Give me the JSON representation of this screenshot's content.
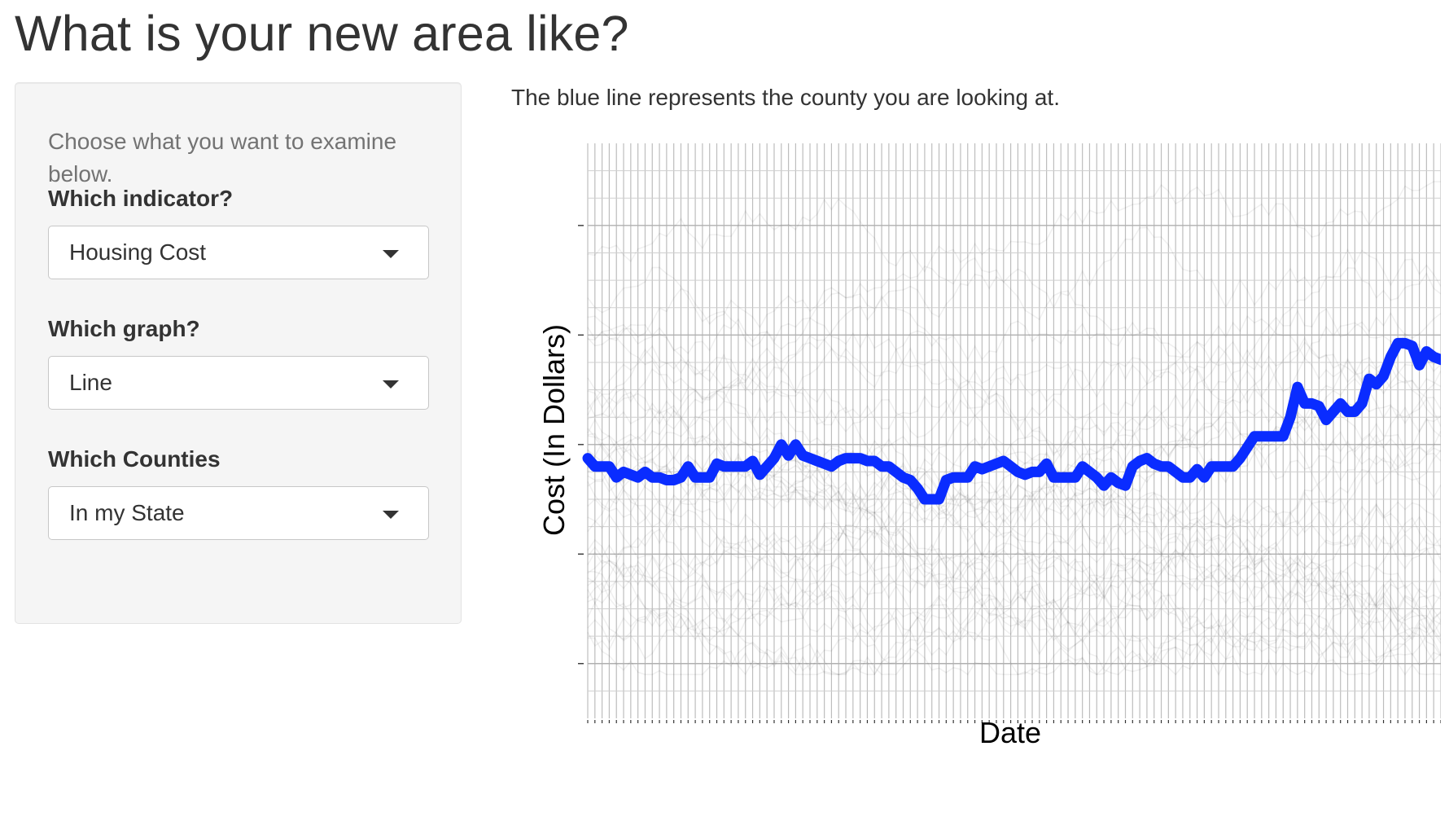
{
  "page": {
    "title": "What is your new area like?"
  },
  "sidebar": {
    "intro": "Choose what you want to examine below.",
    "indicator": {
      "label": "Which indicator?",
      "selected": "Housing Cost",
      "icon": "chevron-down-icon"
    },
    "graph": {
      "label": "Which graph?",
      "selected": "Line",
      "icon": "chevron-down-icon"
    },
    "counties": {
      "label": "Which Counties",
      "selected": "In my State",
      "icon": "chevron-down-icon"
    }
  },
  "main": {
    "caption": "The blue line represents the county you are looking at."
  },
  "chart_data": {
    "type": "line",
    "title": "",
    "xlabel": "Date",
    "ylabel": "Cost (In Dollars)",
    "x_tick_labels_visible": false,
    "y_tick_labels_visible": false,
    "ylim": [
      0,
      10.5
    ],
    "y_major_ticks": [
      1,
      3,
      5,
      7,
      9
    ],
    "grid": true,
    "point_count": 120,
    "highlight_color": "#0a2cff",
    "background_series_color": "#000000",
    "series": [
      {
        "highlight": true,
        "values": [
          4.75,
          4.6,
          4.6,
          4.6,
          4.4,
          4.5,
          4.45,
          4.4,
          4.5,
          4.4,
          4.4,
          4.35,
          4.35,
          4.4,
          4.6,
          4.4,
          4.4,
          4.4,
          4.65,
          4.6,
          4.6,
          4.6,
          4.6,
          4.7,
          4.45,
          4.6,
          4.75,
          5.0,
          4.8,
          5.0,
          4.8,
          4.75,
          4.7,
          4.65,
          4.6,
          4.7,
          4.75,
          4.75,
          4.75,
          4.7,
          4.7,
          4.6,
          4.6,
          4.5,
          4.4,
          4.35,
          4.2,
          4.0,
          4.0,
          4.0,
          4.35,
          4.4,
          4.4,
          4.4,
          4.6,
          4.55,
          4.6,
          4.65,
          4.7,
          4.6,
          4.5,
          4.45,
          4.5,
          4.5,
          4.65,
          4.4,
          4.4,
          4.4,
          4.4,
          4.6,
          4.5,
          4.4,
          4.25,
          4.4,
          4.3,
          4.25,
          4.6,
          4.7,
          4.75,
          4.65,
          4.6,
          4.6,
          4.5,
          4.4,
          4.4,
          4.55,
          4.4,
          4.6,
          4.6,
          4.6,
          4.6,
          4.75,
          4.95,
          5.15,
          5.15,
          5.15,
          5.15,
          5.15,
          5.5,
          6.05,
          5.75,
          5.75,
          5.7,
          5.45,
          5.6,
          5.75,
          5.6,
          5.6,
          5.75,
          6.2,
          6.1,
          6.25,
          6.6,
          6.85,
          6.85,
          6.8,
          6.45,
          6.7,
          6.6,
          6.55
        ]
      }
    ],
    "background_series_count": 40
  }
}
